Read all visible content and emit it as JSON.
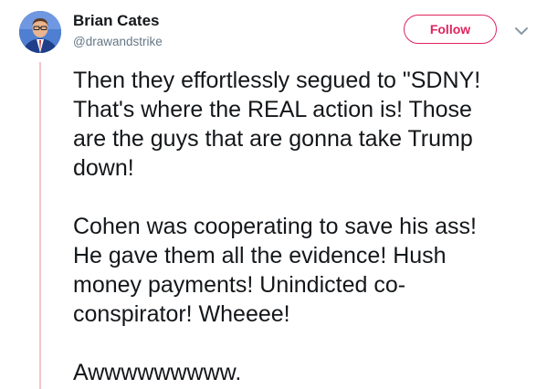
{
  "author": {
    "display_name": "Brian Cates",
    "handle": "@drawandstrike"
  },
  "actions": {
    "follow_label": "Follow",
    "menu_icon": "chevron-down-icon"
  },
  "tweet": {
    "paragraph_1": [
      "Then they effortlessly segued to \"SDNY!",
      "That's where the REAL action is! Those",
      "are the guys that are gonna take Trump",
      "down!"
    ],
    "paragraph_2": [
      "Cohen was cooperating to save his ass!",
      "He gave them all the evidence! Hush",
      "money payments! Unindicted co-",
      "conspirator! Wheeee!"
    ],
    "paragraph_3": [
      "Awwwwwwwww."
    ]
  },
  "colors": {
    "follow_accent": "#e0245e",
    "thread_line": "#f1c6cb",
    "handle_gray": "#657786",
    "text": "#14171a"
  }
}
